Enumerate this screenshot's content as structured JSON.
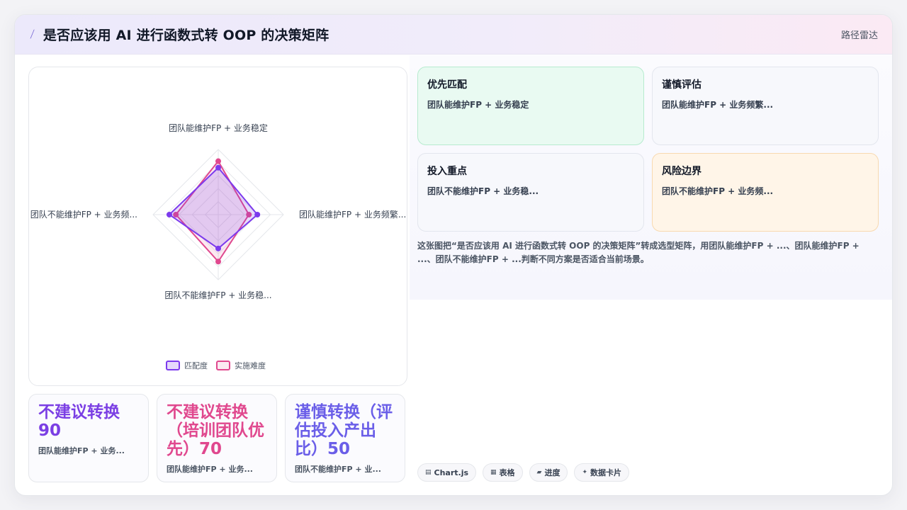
{
  "header": {
    "title": "是否应该用 AI 进行函数式转 OOP 的决策矩阵",
    "tag": "路径雷达",
    "icon": "sparkle-icon"
  },
  "chart_data": {
    "type": "radar",
    "axes": [
      "团队能维护FP + 业务稳定",
      "团队能维护FP + 业务频繁...",
      "团队不能维护FP + 业务稳...",
      "团队不能维护FP + 业务频..."
    ],
    "series": [
      {
        "name": "匹配度",
        "values": [
          0.72,
          0.6,
          0.52,
          0.75
        ],
        "color": "#7c3aed"
      },
      {
        "name": "实施难度",
        "values": [
          0.82,
          0.47,
          0.72,
          0.65
        ],
        "color": "#e0488e"
      }
    ],
    "rlim": [
      0,
      1
    ],
    "grid_levels": 5,
    "legend_position": "bottom"
  },
  "quadrants": [
    {
      "title": "优先匹配",
      "desc": "团队能维护FP + 业务稳定",
      "tone": "green"
    },
    {
      "title": "谨慎评估",
      "desc": "团队能维护FP + 业务频繁...",
      "tone": "neutral"
    },
    {
      "title": "投入重点",
      "desc": "团队不能维护FP + 业务稳...",
      "tone": "neutral"
    },
    {
      "title": "风险边界",
      "desc": "团队不能维护FP + 业务频...",
      "tone": "orange"
    }
  ],
  "summary": "这张图把“是否应该用 AI 进行函数式转 OOP 的决策矩阵”转成选型矩阵，用团队能维护FP + ...、团队能维护FP + ...、团队不能维护FP + ...判断不同方案是否适合当前场景。",
  "stats": [
    {
      "value": "不建议转换90",
      "sub": "团队能维护FP + 业务..."
    },
    {
      "value": "不建议转换（培训团队优先）70",
      "sub": "团队能维护FP + 业务..."
    },
    {
      "value": "谨慎转换（评估投入产出比）50",
      "sub": "团队不能维护FP + 业..."
    }
  ],
  "chips": [
    {
      "icon": "chart-icon",
      "glyph": "▤",
      "label": "Chart.js"
    },
    {
      "icon": "table-icon",
      "glyph": "▦",
      "label": "表格"
    },
    {
      "icon": "progress-icon",
      "glyph": "▰",
      "label": "进度"
    },
    {
      "icon": "card-icon",
      "glyph": "✦",
      "label": "数据卡片"
    }
  ]
}
